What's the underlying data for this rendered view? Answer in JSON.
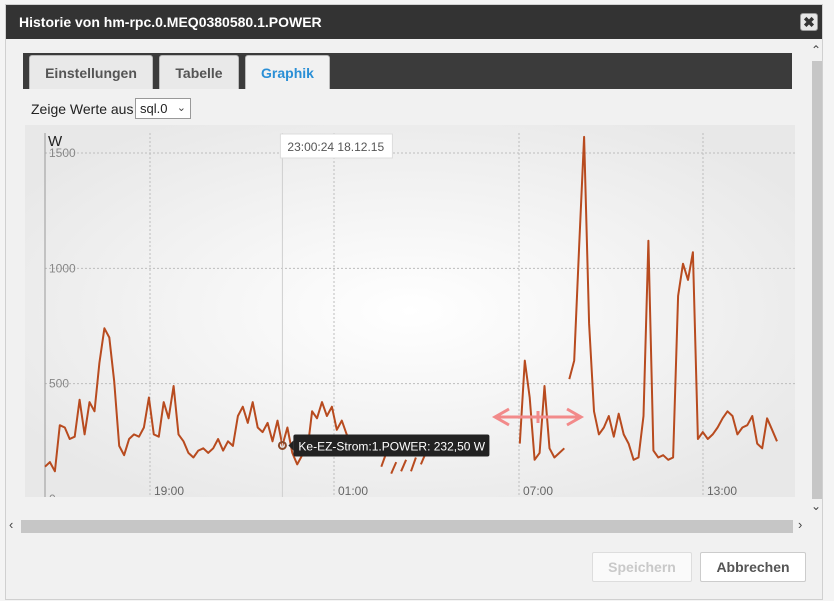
{
  "window": {
    "title": "Historie von hm-rpc.0.MEQ0380580.1.POWER",
    "close_glyph": "✖"
  },
  "tabs": [
    {
      "label": "Einstellungen",
      "active": false
    },
    {
      "label": "Tabelle",
      "active": false
    },
    {
      "label": "Graphik",
      "active": true
    }
  ],
  "source_selector": {
    "label": "Zeige Werte aus",
    "value": "sql.0"
  },
  "chart_data": {
    "type": "line",
    "ylabel": "W",
    "ylim": [
      0,
      1600
    ],
    "yticks": [
      0,
      500,
      1000,
      1500
    ],
    "xticks": [
      "19:00",
      "01:00",
      "07:00",
      "13:00"
    ],
    "grid": true,
    "series": [
      {
        "name": "Ke-EZ-Strom:1.POWER",
        "color": "#b84b1f",
        "segments": [
          [
            [
              0,
              140
            ],
            [
              1,
              160
            ],
            [
              2,
              120
            ],
            [
              3,
              320
            ],
            [
              4,
              310
            ],
            [
              5,
              260
            ],
            [
              6,
              270
            ],
            [
              7,
              430
            ],
            [
              8,
              280
            ],
            [
              9,
              420
            ],
            [
              10,
              380
            ],
            [
              11,
              590
            ],
            [
              12,
              740
            ],
            [
              13,
              700
            ],
            [
              14,
              510
            ],
            [
              15,
              230
            ],
            [
              16,
              190
            ],
            [
              17,
              260
            ],
            [
              18,
              280
            ],
            [
              19,
              270
            ],
            [
              20,
              310
            ],
            [
              21,
              440
            ],
            [
              22,
              280
            ],
            [
              23,
              270
            ],
            [
              24,
              420
            ],
            [
              25,
              350
            ],
            [
              26,
              490
            ],
            [
              27,
              280
            ],
            [
              28,
              250
            ],
            [
              29,
              200
            ],
            [
              30,
              180
            ],
            [
              31,
              210
            ],
            [
              32,
              220
            ],
            [
              33,
              200
            ],
            [
              34,
              220
            ],
            [
              35,
              260
            ],
            [
              36,
              210
            ],
            [
              37,
              250
            ],
            [
              38,
              230
            ],
            [
              39,
              360
            ],
            [
              40,
              400
            ],
            [
              41,
              330
            ],
            [
              42,
              420
            ],
            [
              43,
              310
            ],
            [
              44,
              290
            ],
            [
              45,
              330
            ],
            [
              46,
              250
            ],
            [
              47,
              340
            ],
            [
              48,
              232
            ],
            [
              49,
              310
            ],
            [
              50,
              200
            ],
            [
              51,
              150
            ],
            [
              52,
              190
            ],
            [
              53,
              200
            ],
            [
              54,
              380
            ],
            [
              55,
              350
            ],
            [
              56,
              420
            ],
            [
              57,
              360
            ],
            [
              58,
              400
            ],
            [
              59,
              300
            ],
            [
              60,
              340
            ],
            [
              61,
              280
            ],
            [
              62,
              250
            ],
            [
              63,
              200
            ],
            [
              64,
              260
            ]
          ],
          [
            [
              68,
              140
            ],
            [
              69,
              200
            ]
          ],
          [
            [
              70,
              110
            ],
            [
              71,
              160
            ]
          ],
          [
            [
              72,
              120
            ],
            [
              73,
              170
            ]
          ],
          [
            [
              74,
              120
            ],
            [
              75,
              180
            ]
          ],
          [
            [
              76,
              150
            ],
            [
              77,
              200
            ]
          ],
          [
            [
              79,
              230
            ],
            [
              80,
              260
            ]
          ],
          [
            [
              82,
              200
            ],
            [
              83,
              260
            ]
          ],
          [
            [
              96,
              240
            ],
            [
              97,
              600
            ],
            [
              98,
              440
            ],
            [
              99,
              170
            ],
            [
              100,
              200
            ],
            [
              101,
              490
            ],
            [
              102,
              220
            ],
            [
              103,
              180
            ],
            [
              104,
              200
            ],
            [
              105,
              220
            ]
          ],
          [
            [
              106,
              520
            ],
            [
              107,
              600
            ],
            [
              108,
              1100
            ],
            [
              109,
              1570
            ],
            [
              110,
              760
            ],
            [
              111,
              380
            ],
            [
              112,
              280
            ],
            [
              113,
              310
            ],
            [
              114,
              360
            ],
            [
              115,
              270
            ],
            [
              116,
              370
            ],
            [
              117,
              280
            ],
            [
              118,
              240
            ],
            [
              119,
              170
            ],
            [
              120,
              180
            ],
            [
              121,
              360
            ],
            [
              122,
              1120
            ],
            [
              123,
              210
            ],
            [
              124,
              180
            ],
            [
              125,
              190
            ],
            [
              126,
              170
            ],
            [
              127,
              180
            ],
            [
              128,
              880
            ],
            [
              129,
              1020
            ],
            [
              130,
              950
            ],
            [
              131,
              1070
            ],
            [
              132,
              260
            ],
            [
              133,
              290
            ],
            [
              134,
              260
            ],
            [
              135,
              280
            ],
            [
              136,
              310
            ],
            [
              137,
              350
            ],
            [
              138,
              380
            ],
            [
              139,
              360
            ],
            [
              140,
              280
            ],
            [
              141,
              310
            ],
            [
              142,
              320
            ],
            [
              143,
              360
            ],
            [
              144,
              240
            ],
            [
              145,
              220
            ],
            [
              146,
              350
            ],
            [
              147,
              300
            ],
            [
              148,
              250
            ]
          ]
        ]
      }
    ],
    "cursor": {
      "timestamp": "23:00:24 18.12.15",
      "tooltip": "Ke-EZ-Strom:1.POWER: 232,50 W",
      "x": 48,
      "y": 232
    }
  }
}
